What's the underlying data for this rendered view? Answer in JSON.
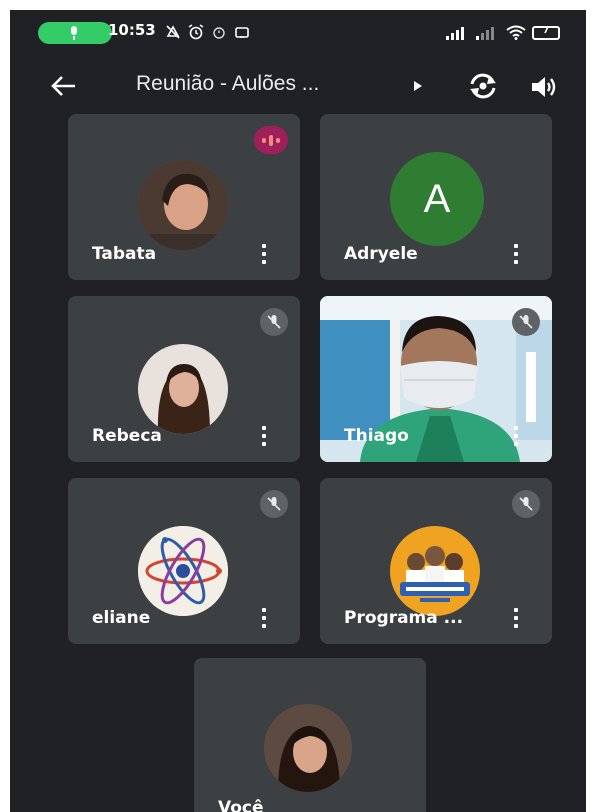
{
  "status_bar": {
    "time": "10:53",
    "battery_level": "7",
    "icons_left": [
      "do-not-disturb-icon",
      "alarm-icon",
      "alarm-outline-icon",
      "cast-icon"
    ],
    "icons_right": [
      "signal-icon",
      "signal-weak-icon",
      "wifi-icon",
      "battery-icon"
    ]
  },
  "app_bar": {
    "title": "Reunião - Aulões ...",
    "actions": [
      "switch-camera",
      "speaker"
    ]
  },
  "participants": [
    {
      "name": "Tabata",
      "avatar": "photo",
      "state": "speaking"
    },
    {
      "name": "Adryele",
      "avatar": "letter",
      "initial": "A",
      "avatar_color": "#2e7d32",
      "state": "unmuted"
    },
    {
      "name": "Rebeca",
      "avatar": "photo",
      "state": "muted"
    },
    {
      "name": "Thiago",
      "avatar": "video",
      "state": "muted"
    },
    {
      "name": "eliane",
      "avatar": "atom-logo",
      "state": "muted"
    },
    {
      "name": "Programa ...",
      "avatar": "group-logo",
      "state": "muted"
    },
    {
      "name": "Você",
      "avatar": "photo",
      "state": "self"
    }
  ],
  "colors": {
    "background": "#202124",
    "tile": "#3c4043",
    "speaking_badge": "#9e1f5a",
    "call_pill": "#33cc66"
  }
}
